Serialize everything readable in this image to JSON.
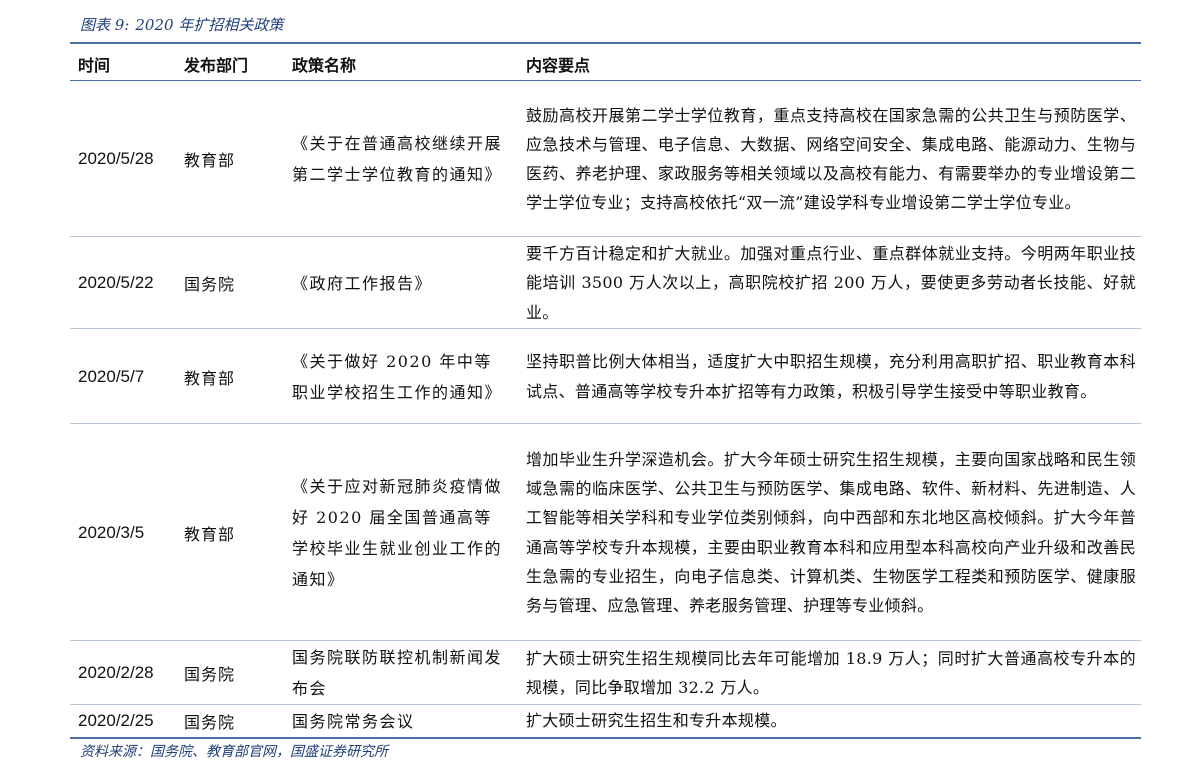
{
  "caption": {
    "label": "图表 9:",
    "title": "2020 年扩招相关政策"
  },
  "table": {
    "headers": {
      "time": "时间",
      "dept": "发布部门",
      "policy": "政策名称",
      "content": "内容要点"
    },
    "rows": [
      {
        "date": "2020/5/28",
        "dept": "教育部",
        "policy": "《关于在普通高校继续开展第二学士学位教育的通知》",
        "content": "鼓励高校开展第二学士学位教育，重点支持高校在国家急需的公共卫生与预防医学、应急技术与管理、电子信息、大数据、网络空间安全、集成电路、能源动力、生物与医药、养老护理、家政服务等相关领域以及高校有能力、有需要举办的专业增设第二学士学位专业；支持高校依托“双一流”建设学科专业增设第二学士学位专业。"
      },
      {
        "date": "2020/5/22",
        "dept": "国务院",
        "policy": "《政府工作报告》",
        "content": "要千方百计稳定和扩大就业。加强对重点行业、重点群体就业支持。今明两年职业技能培训 3500 万人次以上，高职院校扩招 200 万人，要使更多劳动者长技能、好就业。"
      },
      {
        "date": "2020/5/7",
        "dept": "教育部",
        "policy": "《关于做好 2020 年中等职业学校招生工作的通知》",
        "content": "坚持职普比例大体相当，适度扩大中职招生规模，充分利用高职扩招、职业教育本科试点、普通高等学校专升本扩招等有力政策，积极引导学生接受中等职业教育。"
      },
      {
        "date": "2020/3/5",
        "dept": "教育部",
        "policy": "《关于应对新冠肺炎疫情做好 2020 届全国普通高等学校毕业生就业创业工作的通知》",
        "content": "增加毕业生升学深造机会。扩大今年硕士研究生招生规模，主要向国家战略和民生领域急需的临床医学、公共卫生与预防医学、集成电路、软件、新材料、先进制造、人工智能等相关学科和专业学位类别倾斜，向中西部和东北地区高校倾斜。扩大今年普通高等学校专升本规模，主要由职业教育本科和应用型本科高校向产业升级和改善民生急需的专业招生，向电子信息类、计算机类、生物医学工程类和预防医学、健康服务与管理、应急管理、养老服务管理、护理等专业倾斜。"
      },
      {
        "date": "2020/2/28",
        "dept": "国务院",
        "policy": "国务院联防联控机制新闻发布会",
        "content": "扩大硕士研究生招生规模同比去年可能增加 18.9 万人；同时扩大普通高校专升本的规模，同比争取增加 32.2 万人。"
      },
      {
        "date": "2020/2/25",
        "dept": "国务院",
        "policy": "国务院常务会议",
        "content": "扩大硕士研究生招生和专升本规模。"
      }
    ]
  },
  "source": "资料来源：国务院、教育部官网，国盛证券研究所"
}
